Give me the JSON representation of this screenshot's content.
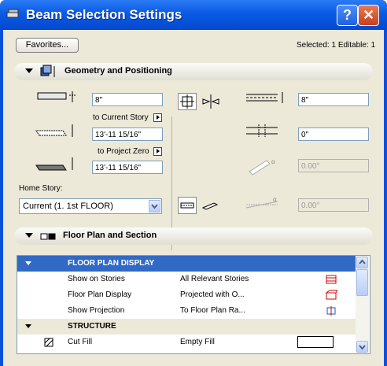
{
  "window": {
    "title": "Beam Selection Settings",
    "help_label": "?",
    "close_label": "✕"
  },
  "toolbar": {
    "favorites_label": "Favorites...",
    "selection_info": "Selected: 1 Editable: 1"
  },
  "geometry": {
    "title": "Geometry and Positioning",
    "height_value": "8\"",
    "to_current_story_label": "to Current Story",
    "current_story_offset": "13'-11 15/16\"",
    "to_project_zero_label": "to Project Zero",
    "project_zero_offset": "13'-11 15/16\"",
    "home_story_label": "Home Story:",
    "home_story_value": "Current (1. 1st FLOOR)",
    "width_value": "8\"",
    "offset_value": "0\"",
    "slant_angle": "0.00°",
    "profile_angle": "0.00°"
  },
  "floor_plan": {
    "title": "Floor Plan and Section",
    "group1": "FLOOR PLAN DISPLAY",
    "rows": [
      {
        "name": "Show on Stories",
        "value": "All Relevant Stories"
      },
      {
        "name": "Floor Plan Display",
        "value": "Projected with O..."
      },
      {
        "name": "Show Projection",
        "value": "To Floor Plan Ra..."
      }
    ],
    "group2": "STRUCTURE",
    "cut_fill_name": "Cut Fill",
    "cut_fill_value": "Empty Fill"
  },
  "colors": {
    "selection": "#316ac5",
    "accent": "#0a53d9"
  }
}
